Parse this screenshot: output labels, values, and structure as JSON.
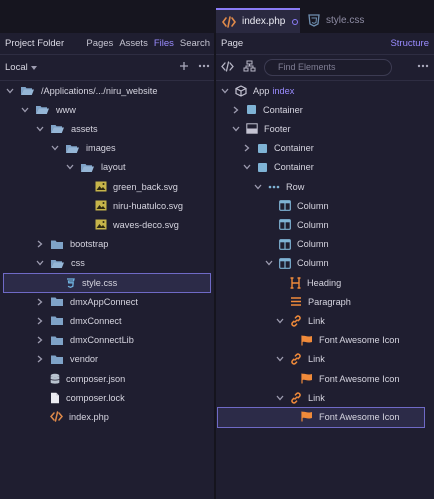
{
  "tabs": [
    {
      "label": "index.php",
      "active": true
    },
    {
      "label": "style.css",
      "active": false
    }
  ],
  "left_panel": {
    "title": "Project Folder",
    "tabs": [
      "Pages",
      "Assets",
      "Files",
      "Search"
    ],
    "active_tab": "Files",
    "location": "Local",
    "tree": [
      {
        "label": "/Applications/.../niru_website",
        "type": "folder-open",
        "level": 0,
        "expand": "down"
      },
      {
        "label": "www",
        "type": "folder-open",
        "level": 1,
        "expand": "down"
      },
      {
        "label": "assets",
        "type": "folder-open",
        "level": 2,
        "expand": "down"
      },
      {
        "label": "images",
        "type": "folder-open",
        "level": 3,
        "expand": "down"
      },
      {
        "label": "layout",
        "type": "folder-open",
        "level": 4,
        "expand": "down"
      },
      {
        "label": "green_back.svg",
        "type": "image",
        "level": 5,
        "expand": ""
      },
      {
        "label": "niru-huatulco.svg",
        "type": "image",
        "level": 5,
        "expand": ""
      },
      {
        "label": "waves-deco.svg",
        "type": "image",
        "level": 5,
        "expand": ""
      },
      {
        "label": "bootstrap",
        "type": "folder",
        "level": 2,
        "expand": "right"
      },
      {
        "label": "css",
        "type": "folder-open",
        "level": 2,
        "expand": "down"
      },
      {
        "label": "style.css",
        "type": "css",
        "level": 3,
        "expand": "",
        "selected": true
      },
      {
        "label": "dmxAppConnect",
        "type": "folder",
        "level": 2,
        "expand": "right"
      },
      {
        "label": "dmxConnect",
        "type": "folder",
        "level": 2,
        "expand": "right"
      },
      {
        "label": "dmxConnectLib",
        "type": "folder",
        "level": 2,
        "expand": "right"
      },
      {
        "label": "vendor",
        "type": "folder",
        "level": 2,
        "expand": "right"
      },
      {
        "label": "composer.json",
        "type": "db",
        "level": 2,
        "expand": ""
      },
      {
        "label": "composer.lock",
        "type": "file",
        "level": 2,
        "expand": ""
      },
      {
        "label": "index.php",
        "type": "code",
        "level": 2,
        "expand": ""
      }
    ]
  },
  "right_panel": {
    "title": "Page",
    "structure_label": "Structure",
    "search_placeholder": "Find Elements",
    "tree": [
      {
        "label": "App",
        "suffix": "index",
        "type": "app",
        "level": 0,
        "expand": "down"
      },
      {
        "label": "Container",
        "type": "square",
        "level": 1,
        "expand": "right"
      },
      {
        "label": "Footer",
        "type": "footer",
        "level": 1,
        "expand": "down"
      },
      {
        "label": "Container",
        "type": "square",
        "level": 2,
        "expand": "right"
      },
      {
        "label": "Container",
        "type": "square",
        "level": 2,
        "expand": "down"
      },
      {
        "label": "Row",
        "type": "row",
        "level": 3,
        "expand": "down"
      },
      {
        "label": "Column",
        "type": "column",
        "level": 4,
        "expand": ""
      },
      {
        "label": "Column",
        "type": "column",
        "level": 4,
        "expand": ""
      },
      {
        "label": "Column",
        "type": "column",
        "level": 4,
        "expand": ""
      },
      {
        "label": "Column",
        "type": "column",
        "level": 4,
        "expand": "down"
      },
      {
        "label": "Heading",
        "type": "heading",
        "level": 5,
        "expand": ""
      },
      {
        "label": "Paragraph",
        "type": "paragraph",
        "level": 5,
        "expand": ""
      },
      {
        "label": "Link",
        "type": "link",
        "level": 5,
        "expand": "down"
      },
      {
        "label": "Font Awesome Icon",
        "type": "flag",
        "level": 6,
        "expand": ""
      },
      {
        "label": "Link",
        "type": "link",
        "level": 5,
        "expand": "down"
      },
      {
        "label": "Font Awesome Icon",
        "type": "flag",
        "level": 6,
        "expand": ""
      },
      {
        "label": "Link",
        "type": "link",
        "level": 5,
        "expand": "down"
      },
      {
        "label": "Font Awesome Icon",
        "type": "flag",
        "level": 6,
        "expand": "",
        "selected": true
      }
    ]
  },
  "colors": {
    "accent": "#9a8cff",
    "folder": "#7fa3c8",
    "image": "#c7b54a",
    "css": "#6fb3e0",
    "code": "#e08a4a",
    "square": "#7fb3d5",
    "flag": "#f08a3a"
  }
}
